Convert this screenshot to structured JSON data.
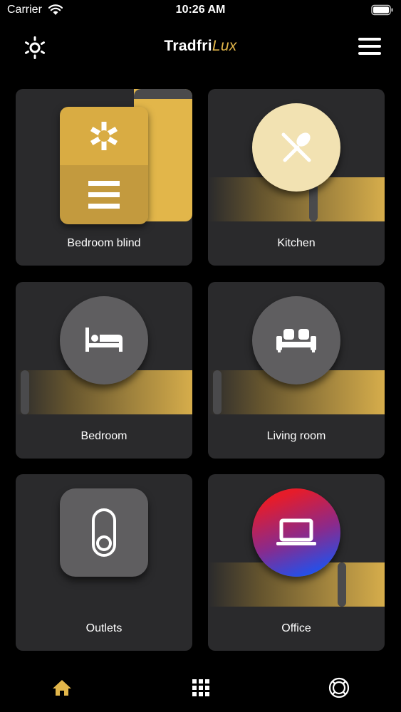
{
  "status_bar": {
    "carrier": "Carrier",
    "time": "10:26 AM"
  },
  "header": {
    "title_main": "Tradfri",
    "title_accent": "Lux"
  },
  "tiles": [
    {
      "label": "Bedroom blind",
      "type": "blind",
      "icon_top": "asterisk-icon",
      "icon_bottom": "lines-icon"
    },
    {
      "label": "Kitchen",
      "type": "light",
      "icon": "fork-spoon-icon",
      "brightness": 0.6
    },
    {
      "label": "Bedroom",
      "type": "light",
      "icon": "bed-icon",
      "brightness": 0.03
    },
    {
      "label": "Living room",
      "type": "light",
      "icon": "sofa-icon",
      "brightness": 0.03
    },
    {
      "label": "Outlets",
      "type": "outlet",
      "icon": "switch-icon"
    },
    {
      "label": "Office",
      "type": "light",
      "icon": "laptop-icon",
      "brightness": 0.77
    }
  ],
  "tab_bar": {
    "items": [
      "home-icon",
      "grid-icon",
      "lifebuoy-icon"
    ],
    "active": "home-icon"
  },
  "colors": {
    "accent": "#e2b64a",
    "tile_bg": "#2a2a2c",
    "kitchen_circle": "#f2e2b2",
    "office_gradient_top": "#e61c2a",
    "office_gradient_bottom": "#1f52ee"
  }
}
